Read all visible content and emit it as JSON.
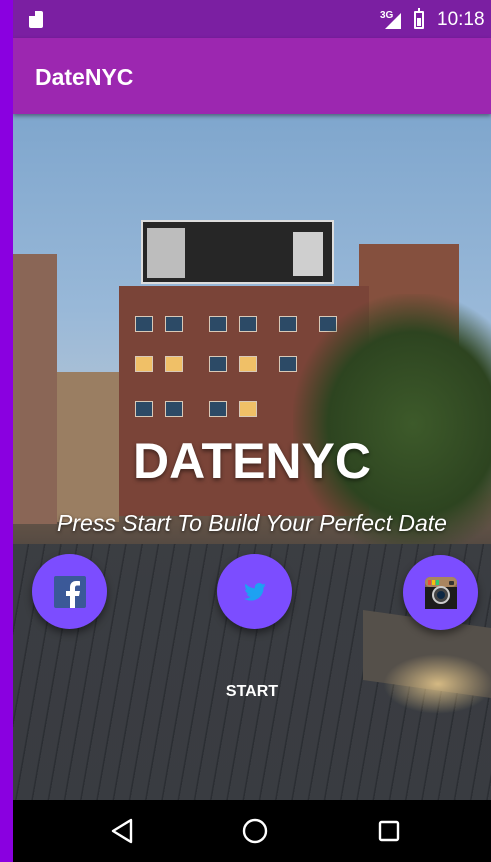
{
  "status_bar": {
    "network_label": "3G",
    "time": "10:18"
  },
  "app_bar": {
    "title": "DateNYC"
  },
  "main": {
    "headline": "DATENYC",
    "tagline": "Press Start To Build Your Perfect Date",
    "start_label": "START",
    "social_buttons": [
      {
        "icon": "facebook-icon"
      },
      {
        "icon": "twitter-icon"
      },
      {
        "icon": "instagram-icon"
      }
    ]
  },
  "nav_bar": {
    "buttons": [
      "back-icon",
      "home-icon",
      "recent-apps-icon"
    ]
  },
  "colors": {
    "status_bar": "#7b1fa2",
    "app_bar": "#9c27b0",
    "fab": "#7c4dff",
    "emulator_edge": "#8a00e0"
  }
}
